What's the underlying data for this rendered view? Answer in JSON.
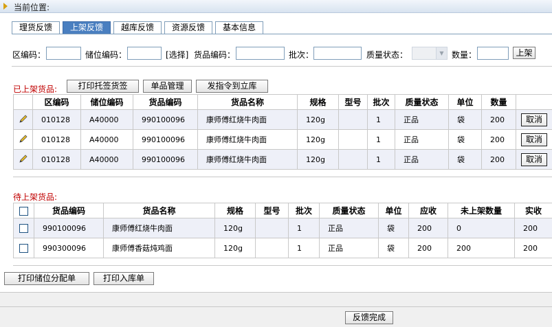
{
  "location": {
    "label": "当前位置:"
  },
  "tabs": [
    "理货反馈",
    "上架反馈",
    "越库反馈",
    "资源反馈",
    "基本信息"
  ],
  "active_tab": 1,
  "filters": {
    "area_code_label": "区编码：",
    "area_code_value": "",
    "bin_code_label": "储位编码：",
    "bin_code_value": "",
    "select_link": "[选择]",
    "goods_code_label": "货品编码：",
    "goods_code_value": "",
    "batch_label": "批次：",
    "batch_value": "",
    "quality_label": "质量状态：",
    "quality_value": "",
    "qty_label": "数量：",
    "qty_value": "",
    "shelve_button": "上架"
  },
  "shelved": {
    "label": "已上架货品:",
    "buttons": [
      "打印托签货签",
      "单品管理",
      "发指令到立库"
    ],
    "columns": [
      "",
      "区编码",
      "储位编码",
      "货品编码",
      "货品名称",
      "规格",
      "型号",
      "批次",
      "质量状态",
      "单位",
      "数量",
      ""
    ],
    "rows": [
      {
        "area": "010128",
        "bin": "A40000",
        "code": "990100096",
        "name": "康师傅红烧牛肉面",
        "spec": "120g",
        "model": "",
        "batch": "1",
        "quality": "正品",
        "unit": "袋",
        "qty": "200",
        "action": "取消"
      },
      {
        "area": "010128",
        "bin": "A40000",
        "code": "990100096",
        "name": "康师傅红烧牛肉面",
        "spec": "120g",
        "model": "",
        "batch": "1",
        "quality": "正品",
        "unit": "袋",
        "qty": "200",
        "action": "取消"
      },
      {
        "area": "010128",
        "bin": "A40000",
        "code": "990100096",
        "name": "康师傅红烧牛肉面",
        "spec": "120g",
        "model": "",
        "batch": "1",
        "quality": "正品",
        "unit": "袋",
        "qty": "200",
        "action": "取消"
      }
    ]
  },
  "pending": {
    "label": "待上架货品:",
    "columns": [
      "",
      "货品编码",
      "货品名称",
      "规格",
      "型号",
      "批次",
      "质量状态",
      "单位",
      "应收",
      "未上架数量",
      "实收"
    ],
    "rows": [
      {
        "code": "990100096",
        "name": "康师傅红烧牛肉面",
        "spec": "120g",
        "model": "",
        "batch": "1",
        "quality": "正品",
        "unit": "袋",
        "due": "200",
        "unshelved": "0",
        "received": "200"
      },
      {
        "code": "990300096",
        "name": "康师傅香菇炖鸡面",
        "spec": "120g",
        "model": "",
        "batch": "1",
        "quality": "正品",
        "unit": "袋",
        "due": "200",
        "unshelved": "200",
        "received": "200"
      }
    ]
  },
  "bottom_buttons": [
    "打印储位分配单",
    "打印入库单"
  ],
  "footer": {
    "finish_button": "反馈完成"
  },
  "colors": {
    "accent": "#4a7fc0",
    "section_label": "#c00000",
    "row_alt": "#eef0f8"
  },
  "icons": {
    "edit": "pencil-icon",
    "location": "triangle-arrow-icon"
  }
}
